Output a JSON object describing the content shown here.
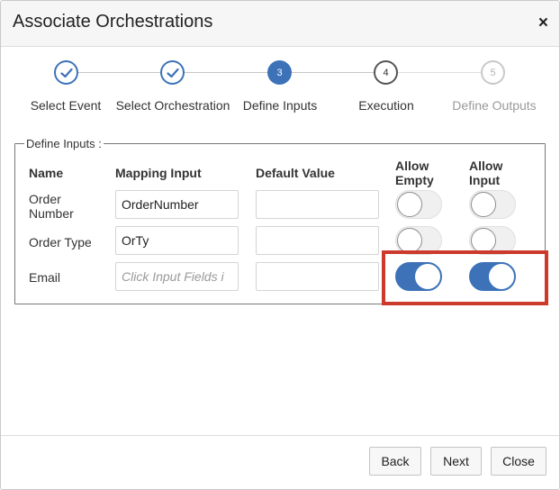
{
  "dialog": {
    "title": "Associate Orchestrations",
    "close_glyph": "×"
  },
  "train": {
    "steps": [
      {
        "label": "Select Event",
        "state": "complete",
        "icon": "check-icon"
      },
      {
        "label": "Select Orchestration",
        "state": "complete",
        "icon": "check-icon"
      },
      {
        "label": "Define Inputs",
        "number": "3",
        "state": "current"
      },
      {
        "label": "Execution",
        "number": "4",
        "state": "upcoming"
      },
      {
        "label": "Define Outputs",
        "number": "5",
        "state": "disabled"
      }
    ]
  },
  "define_inputs": {
    "legend": "Define Inputs :",
    "headers": {
      "name": "Name",
      "mapping_input": "Mapping Input",
      "default_value": "Default Value",
      "allow_empty": "Allow Empty",
      "allow_input": "Allow Input"
    },
    "rows": [
      {
        "name": "Order Number",
        "mapping_input": "OrderNumber",
        "mapping_placeholder": "",
        "default_value": "",
        "allow_empty": false,
        "allow_input": false
      },
      {
        "name": "Order Type",
        "mapping_input": "OrTy",
        "mapping_placeholder": "",
        "default_value": "",
        "allow_empty": false,
        "allow_input": false
      },
      {
        "name": "Email",
        "mapping_input": "",
        "mapping_placeholder": "Click Input Fields i",
        "default_value": "",
        "allow_empty": true,
        "allow_input": true
      }
    ]
  },
  "footer": {
    "back_label": "Back",
    "next_label": "Next",
    "close_label": "Close"
  },
  "colors": {
    "accent": "#3d72b8",
    "highlight": "#cc3a2c"
  }
}
